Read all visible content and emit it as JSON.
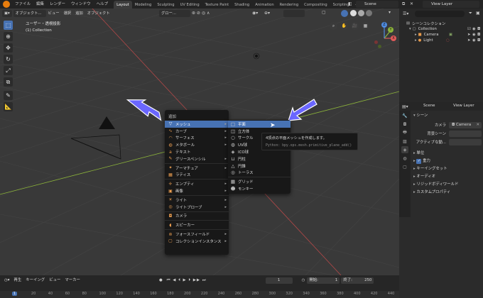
{
  "topbar": {
    "menus": [
      "ファイル",
      "編集",
      "レンダー",
      "ウィンドウ",
      "ヘルプ"
    ],
    "workspaces": [
      "Layout",
      "Modeling",
      "Sculpting",
      "UV Editing",
      "Texture Paint",
      "Shading",
      "Animation",
      "Rendering",
      "Compositing",
      "Scripting"
    ],
    "active_workspace": "Layout",
    "scene": "Scene",
    "view_layer": "View Layer"
  },
  "viewport": {
    "mode": "オブジェクト...",
    "menus": [
      "ビュー",
      "選択",
      "追加",
      "オブジェクト"
    ],
    "orientation": "グロー...",
    "view_name": "ユーザー・透視投影",
    "collection": "(1) Collection",
    "gizmo": {
      "x": "X",
      "y": "Y",
      "z": "Z"
    }
  },
  "add_menu": {
    "title": "追加",
    "items": [
      {
        "label": "メッシュ",
        "icon": "mesh-icon",
        "submenu": true,
        "highlight": true
      },
      {
        "label": "カーブ",
        "icon": "curve-icon",
        "submenu": true
      },
      {
        "label": "サーフェス",
        "icon": "surface-icon",
        "submenu": true
      },
      {
        "label": "メタボール",
        "icon": "metaball-icon",
        "submenu": true
      },
      {
        "label": "テキスト",
        "icon": "text-icon",
        "submenu": false
      },
      {
        "label": "グリースペンシル",
        "icon": "grease-pencil-icon",
        "submenu": true
      },
      {
        "label": "アーマチュア",
        "icon": "armature-icon",
        "submenu": true
      },
      {
        "label": "ラティス",
        "icon": "lattice-icon",
        "submenu": false
      },
      {
        "label": "エンプティ",
        "icon": "empty-icon",
        "submenu": true
      },
      {
        "label": "画像",
        "icon": "image-icon",
        "submenu": true
      },
      {
        "label": "ライト",
        "icon": "light-icon",
        "submenu": true
      },
      {
        "label": "ライトプローブ",
        "icon": "light-probe-icon",
        "submenu": true
      },
      {
        "label": "カメラ",
        "icon": "camera-icon",
        "submenu": false
      },
      {
        "label": "スピーカー",
        "icon": "speaker-icon",
        "submenu": false
      },
      {
        "label": "フォースフィールド",
        "icon": "force-field-icon",
        "submenu": true
      },
      {
        "label": "コレクションインスタンス",
        "icon": "collection-instance-icon",
        "submenu": true
      }
    ]
  },
  "mesh_menu": {
    "items": [
      {
        "label": "平面",
        "icon": "plane-icon",
        "highlight": true
      },
      {
        "label": "立方体",
        "icon": "cube-icon"
      },
      {
        "label": "サークル",
        "icon": "circle-icon"
      },
      {
        "label": "UV球",
        "icon": "uv-sphere-icon"
      },
      {
        "label": "ICO球",
        "icon": "ico-sphere-icon"
      },
      {
        "label": "円柱",
        "icon": "cylinder-icon"
      },
      {
        "label": "円錐",
        "icon": "cone-icon"
      },
      {
        "label": "トーラス",
        "icon": "torus-icon"
      },
      {
        "label": "グリッド",
        "icon": "grid-icon"
      },
      {
        "label": "モンキー",
        "icon": "monkey-icon"
      }
    ]
  },
  "tooltip": {
    "text": "4頂点の平面メッシュを作成します。",
    "python": "Python: bpy.ops.mesh.primitive_plane_add()"
  },
  "timeline": {
    "menus": [
      "再生",
      "キーイング",
      "ビュー",
      "マーカー"
    ],
    "current_frame": "1",
    "start_label": "開始:",
    "start": "1",
    "end_label": "終了:",
    "end": "250",
    "ruler": [
      "1",
      "20",
      "40",
      "60",
      "80",
      "100",
      "120",
      "140",
      "160",
      "180",
      "200",
      "220",
      "240",
      "260",
      "280",
      "300",
      "320",
      "340",
      "360",
      "380",
      "400",
      "420",
      "440"
    ]
  },
  "outliner": {
    "root": "シーンコレクション",
    "collection": "Collection",
    "objects": [
      "Camera",
      "Light"
    ]
  },
  "properties": {
    "scene_field": "Scene",
    "view_layer_field": "View Layer",
    "panel_title": "シーン",
    "camera_label": "カメラ",
    "camera_value": "Camera",
    "bg_scene_label": "背景シーン",
    "active_clip_label": "アクティブな動...",
    "sections": [
      "単位",
      "重力",
      "キーイングセット",
      "オーディオ",
      "リジッドボディワールド",
      "カスタムプロパティ"
    ],
    "gravity_checked": true
  },
  "colors": {
    "accent": "#4772b3",
    "x_axis": "#e05a5a",
    "y_axis": "#8cb43a",
    "z_axis": "#4f8be0",
    "arrow": "#6a66ff"
  }
}
